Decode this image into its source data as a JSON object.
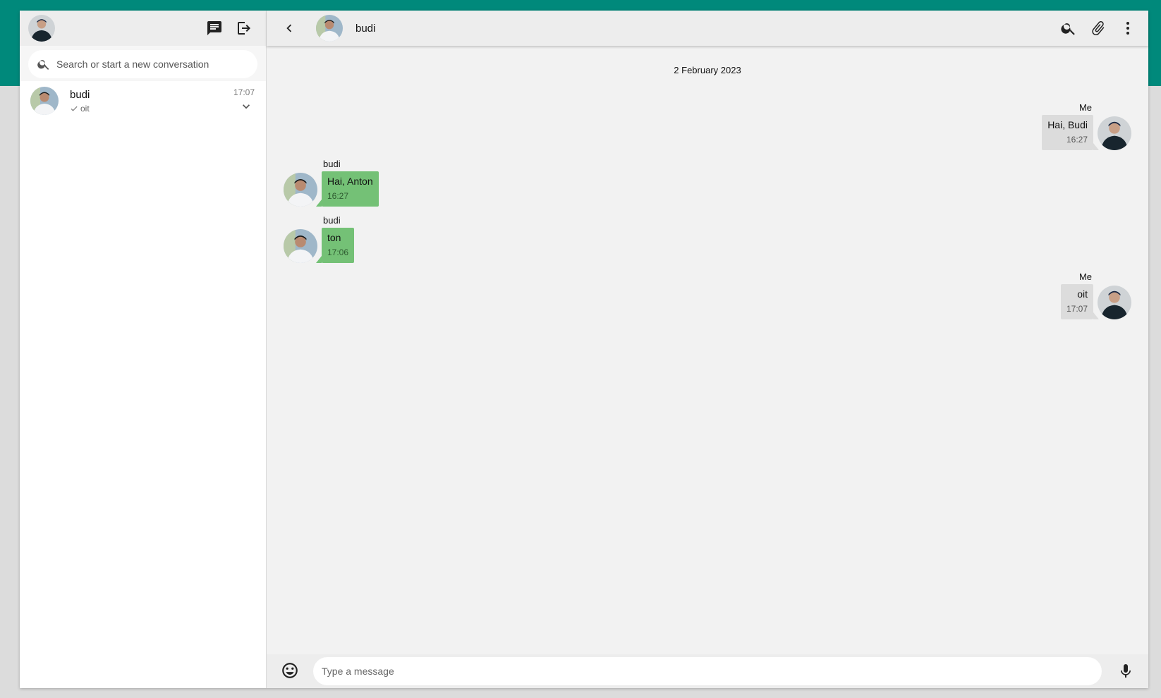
{
  "colors": {
    "brand": "#00897b",
    "incoming_bubble": "#74c176",
    "outgoing_bubble": "#dcdcdc"
  },
  "sidebar": {
    "user_avatar": "user-avatar",
    "actions": [
      {
        "icon": "new-chat-icon"
      },
      {
        "icon": "logout-icon"
      }
    ],
    "search": {
      "placeholder": "Search or start a new conversation"
    },
    "conversations": [
      {
        "name": "budi",
        "last_message": "oit",
        "time": "17:07",
        "status_icon": "check-icon"
      }
    ]
  },
  "chat": {
    "title": "budi",
    "date_label": "2 February 2023",
    "messages": [
      {
        "direction": "out",
        "sender": "Me",
        "text": "Hai, Budi",
        "time": "16:27"
      },
      {
        "direction": "in",
        "sender": "budi",
        "text": "Hai, Anton",
        "time": "16:27"
      },
      {
        "direction": "in",
        "sender": "budi",
        "text": "ton",
        "time": "17:06"
      },
      {
        "direction": "out",
        "sender": "Me",
        "text": "oit",
        "time": "17:07"
      }
    ],
    "input": {
      "placeholder": "Type a message"
    }
  }
}
